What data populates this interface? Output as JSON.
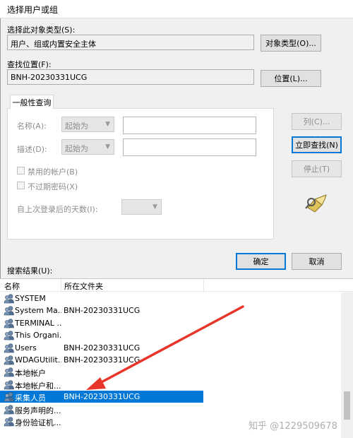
{
  "window": {
    "title": "选择用户或组"
  },
  "object_type": {
    "label": "选择此对象类型(S):",
    "value": "用户、组或内置安全主体",
    "button": "对象类型(O)..."
  },
  "location": {
    "label": "查找位置(F):",
    "value": "BNH-20230331UCG",
    "button": "位置(L)..."
  },
  "query": {
    "tab": "一般性查询",
    "name_label": "名称(A):",
    "name_mode": "起始为",
    "desc_label": "描述(D):",
    "desc_mode": "起始为",
    "disabled_accounts": "禁用的帐户(B)",
    "non_expiring": "不过期密码(X)",
    "days_label": "自上次登录后的天数(I):"
  },
  "buttons": {
    "columns": "列(C)...",
    "find_now": "立即查找(N)",
    "stop": "停止(T)",
    "ok": "确定",
    "cancel": "取消"
  },
  "results": {
    "label": "搜索结果(U):",
    "columns": [
      "名称",
      "所在文件夹"
    ],
    "rows": [
      {
        "name": "SYSTEM",
        "folder": ""
      },
      {
        "name": "System Ma...",
        "folder": "BNH-20230331UCG"
      },
      {
        "name": "TERMINAL ...",
        "folder": ""
      },
      {
        "name": "This Organi...",
        "folder": ""
      },
      {
        "name": "Users",
        "folder": "BNH-20230331UCG"
      },
      {
        "name": "WDAGUtilit...",
        "folder": "BNH-20230331UCG"
      },
      {
        "name": "本地帐户",
        "folder": ""
      },
      {
        "name": "本地帐户和...",
        "folder": ""
      },
      {
        "name": "采集人员",
        "folder": "BNH-20230331UCG",
        "selected": true
      },
      {
        "name": "服务声明的...",
        "folder": ""
      },
      {
        "name": "身份验证机...",
        "folder": ""
      }
    ]
  },
  "watermark": "知乎 @1229509678",
  "colors": {
    "selection": "#0078d7",
    "arrow": "#e8352a"
  }
}
